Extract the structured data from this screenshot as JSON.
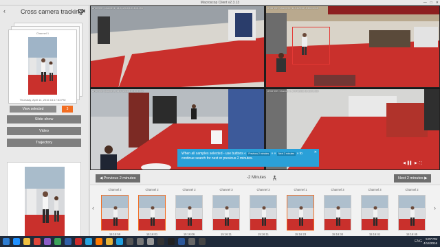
{
  "window": {
    "title": "Macroscop Client v2.3.13",
    "minimize": "—",
    "maximize": "□",
    "close": "✕"
  },
  "sidebar": {
    "back_glyph": "‹",
    "title": "Cross camera tracking",
    "camera_icon": "camera-icon",
    "stack_card": {
      "caption": "Channel 1",
      "timestamp": "Thursday, April 14, 2016 15:17:53 PM"
    },
    "view_selected_label": "View selected",
    "selected_count": "3",
    "buttons": [
      "Slide show",
      "Video",
      "Trajectory"
    ]
  },
  "cameras": [
    {
      "label": "ARCHIVE: Channel 1, 14.04.2016 15:16:01.000"
    },
    {
      "label": "ARCHIVE: Channel 2, 14.04.2016 15:16:01.000"
    },
    {
      "label": "ARCHIVE: Channel 3, 14.04.2016 15:16:01.000"
    },
    {
      "label": "ARCHIVE: Channel 4, 14.04.2016 15:16:01.000"
    }
  ],
  "notification": {
    "text_before": "When all samples selected - use buttons «",
    "chip_prev": "Previous 2 minutes",
    "text_mid": "» «",
    "chip_next": "Next 2 minutes",
    "text_after": "» to continue search for next or previous 2 minutes.",
    "close_glyph": "✕"
  },
  "playback": [
    "◀",
    "▌▌",
    "▶",
    "⛶"
  ],
  "controls": {
    "prev_label": "Previous 2 minutes",
    "range_label": "-2 Minutes",
    "next_label": "Next 2 minutes",
    "prev_glyph": "◀",
    "next_glyph": "▶",
    "search_icon": "tracking-icon"
  },
  "strip": {
    "left_arrow": "‹",
    "right_arrow": "›",
    "items": [
      {
        "camera": "Channel 2",
        "time": "15:15:59",
        "selected": true
      },
      {
        "camera": "Channel 2",
        "time": "15:16:01",
        "selected": true
      },
      {
        "camera": "Channel 2",
        "time": "15:16:06",
        "selected": false
      },
      {
        "camera": "Channel 3",
        "time": "15:16:11",
        "selected": false
      },
      {
        "camera": "Channel 3",
        "time": "15:16:11",
        "selected": false
      },
      {
        "camera": "Channel 1",
        "time": "15:16:23",
        "selected": true
      },
      {
        "camera": "Channel 3",
        "time": "15:16:34",
        "selected": false
      },
      {
        "camera": "Channel 3",
        "time": "15:16:41",
        "selected": false
      },
      {
        "camera": "Channel 2",
        "time": "15:16:45",
        "selected": false
      }
    ]
  },
  "taskbar": {
    "apps": [
      "windows-icon",
      "ie-icon",
      "explorer-icon",
      "chrome-icon",
      "app-icon",
      "app-icon",
      "store-icon",
      "yandex-icon",
      "photoshop-icon",
      "media-icon",
      "folder-icon",
      "skype-icon",
      "app-icon",
      "app-icon",
      "app-icon",
      "player-icon",
      "steam-icon",
      "word-icon",
      "app-icon",
      "app-icon"
    ],
    "time": "5:07 PM",
    "date": "4/14/2016",
    "lang": "ENG"
  },
  "colors": {
    "accent": "#f26d21",
    "notify": "#2aa0d8",
    "floor_red": "#c9302c",
    "button_gray": "#7f7f7f"
  }
}
